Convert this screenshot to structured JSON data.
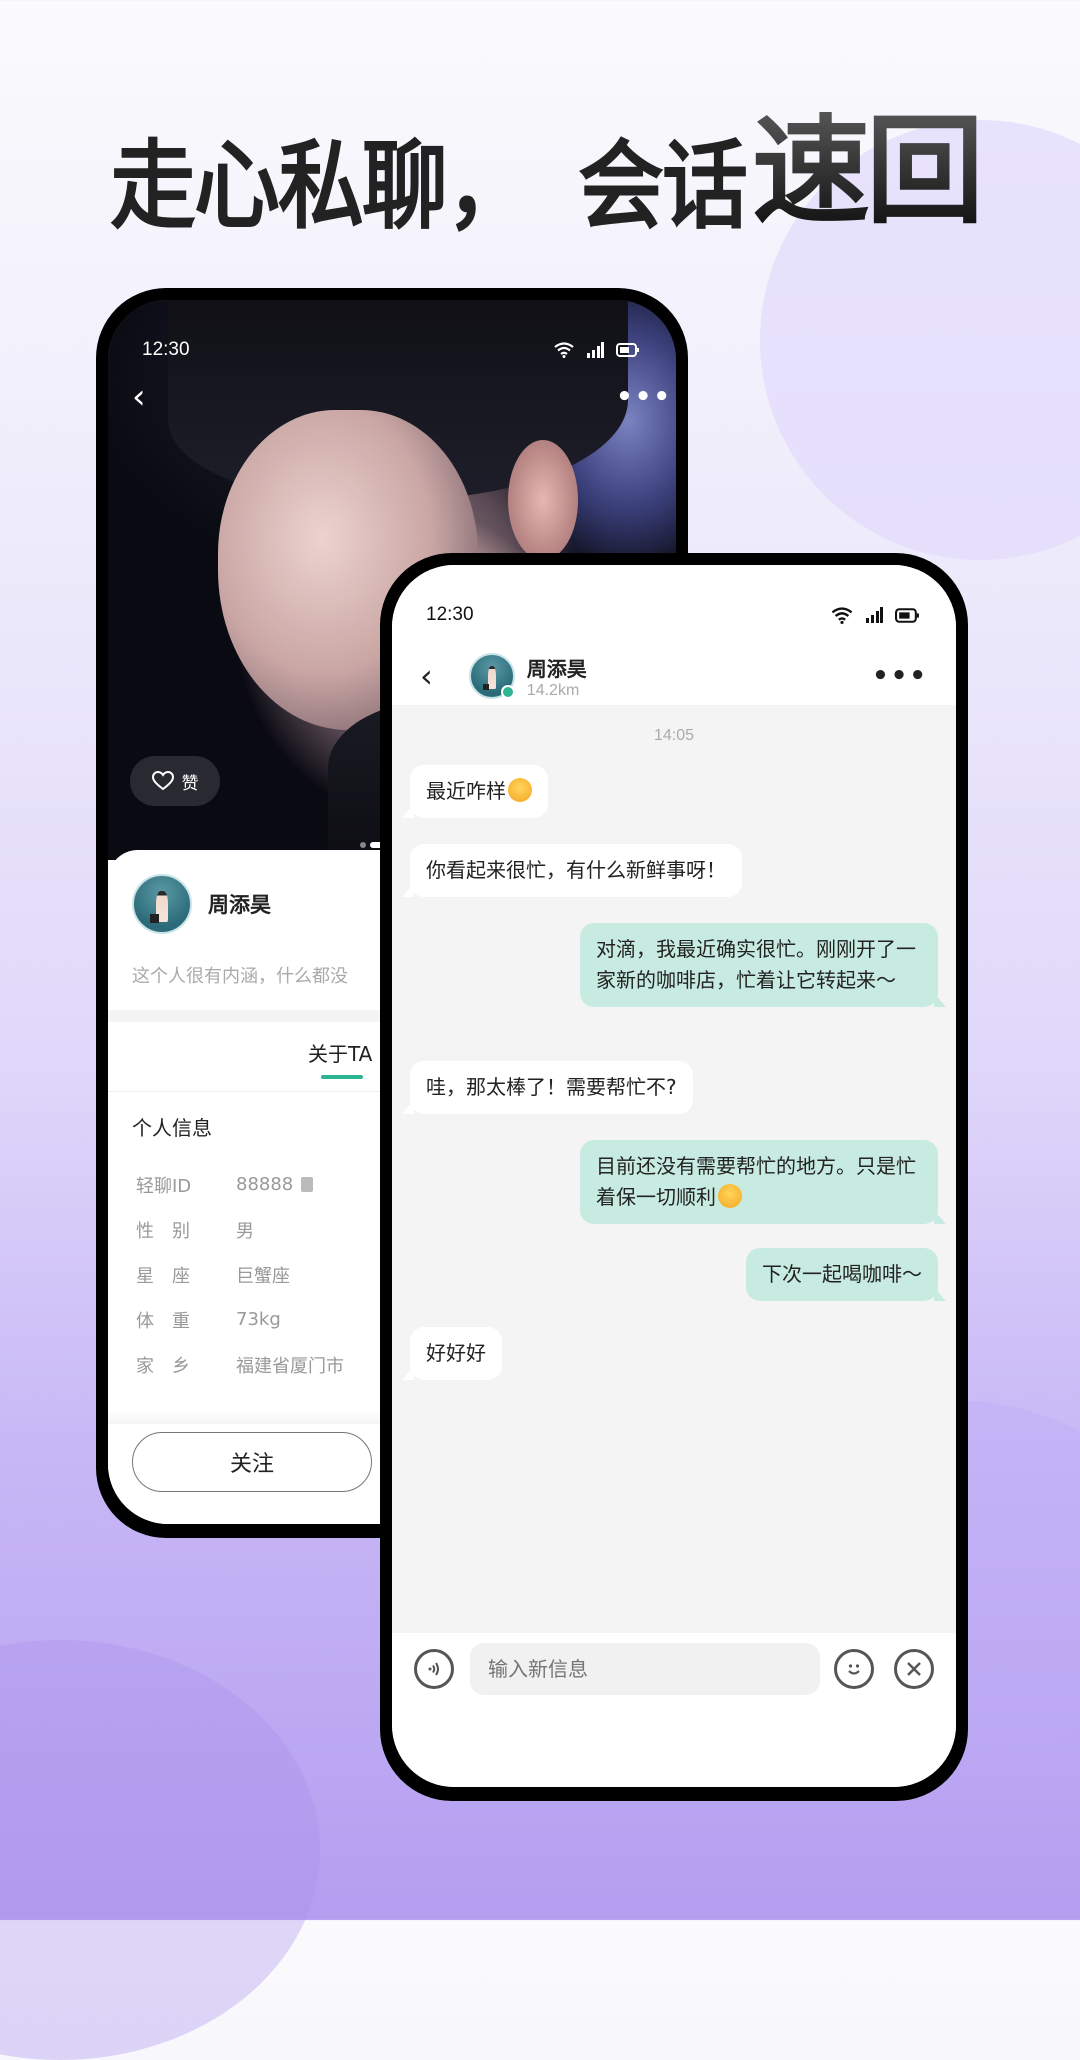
{
  "headline": {
    "part1": "走心私聊，",
    "part2": "会话",
    "part3": "速回"
  },
  "profile_phone": {
    "status_bar": {
      "time": "12:30",
      "icons": [
        "wifi-icon",
        "signal-icon",
        "battery-icon"
      ]
    },
    "like_label": "赞",
    "user": {
      "name": "周添昊",
      "bio": "这个人很有内涵，什么都没"
    },
    "tab_label": "关于TA",
    "section_title": "个人信息",
    "info_rows": [
      {
        "key": "轻聊ID",
        "value": "88888"
      },
      {
        "key": "性　别",
        "value": "男"
      },
      {
        "key": "星　座",
        "value": "巨蟹座"
      },
      {
        "key": "体　重",
        "value": "73kg"
      },
      {
        "key": "家　乡",
        "value": "福建省厦门市"
      }
    ],
    "follow_label": "关注"
  },
  "chat_phone": {
    "status_bar": {
      "time": "12:30",
      "icons": [
        "wifi-icon",
        "signal-icon",
        "battery-icon"
      ]
    },
    "contact": {
      "name": "周添昊",
      "distance": "14.2km",
      "online": true
    },
    "timestamp": "14:05",
    "messages": [
      {
        "side": "in",
        "text": "最近咋样",
        "emoji": "smiling-face"
      },
      {
        "side": "in",
        "text": "你看起来很忙，有什么新鲜事呀！"
      },
      {
        "side": "out",
        "text": "对滴，我最近确实很忙。刚刚开了一家新的咖啡店，忙着让它转起来～"
      },
      {
        "side": "in",
        "text": "哇，那太棒了！需要帮忙不?"
      },
      {
        "side": "out",
        "text": "目前还没有需要帮忙的地方。只是忙着保一切顺利",
        "emoji": "crying-face"
      },
      {
        "side": "out",
        "text": "下次一起喝咖啡～"
      },
      {
        "side": "in",
        "text": "好好好"
      }
    ],
    "input": {
      "placeholder": "输入新信息",
      "value": ""
    }
  },
  "colors": {
    "accent": "#2db593",
    "outgoing_bubble": "#c8ebe1",
    "incoming_bubble": "#ffffff",
    "chat_bg": "#f4f4f4"
  }
}
